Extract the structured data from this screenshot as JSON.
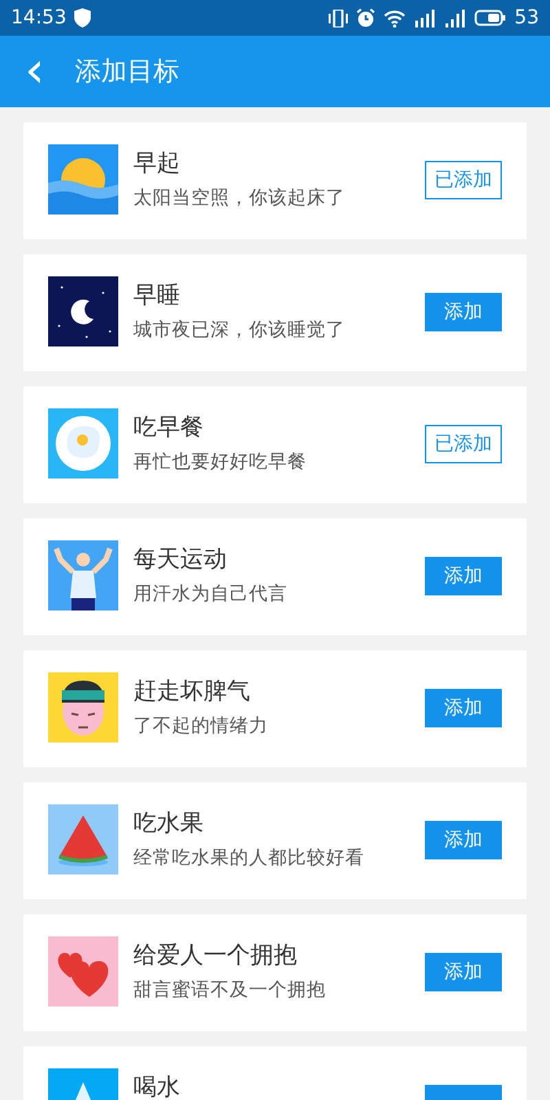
{
  "status_bar": {
    "time": "14:53",
    "battery": "53"
  },
  "header": {
    "back": "‹",
    "title": "添加目标"
  },
  "goals": [
    {
      "kind": "sunrise",
      "title": "早起",
      "subtitle": "太阳当空照，你该起床了",
      "added": true,
      "button": "已添加"
    },
    {
      "kind": "moon",
      "title": "早睡",
      "subtitle": "城市夜已深，你该睡觉了",
      "added": false,
      "button": "添加"
    },
    {
      "kind": "egg",
      "title": "吃早餐",
      "subtitle": "再忙也要好好吃早餐",
      "added": true,
      "button": "已添加"
    },
    {
      "kind": "athlete",
      "title": "每天运动",
      "subtitle": "用汗水为自己代言",
      "added": false,
      "button": "添加"
    },
    {
      "kind": "angry",
      "title": "赶走坏脾气",
      "subtitle": "了不起的情绪力",
      "added": false,
      "button": "添加"
    },
    {
      "kind": "watermelon",
      "title": "吃水果",
      "subtitle": "经常吃水果的人都比较好看",
      "added": false,
      "button": "添加"
    },
    {
      "kind": "hearts",
      "title": "给爱人一个拥抱",
      "subtitle": "甜言蜜语不及一个拥抱",
      "added": false,
      "button": "添加"
    },
    {
      "kind": "drop",
      "title": "喝水",
      "added": false
    }
  ]
}
